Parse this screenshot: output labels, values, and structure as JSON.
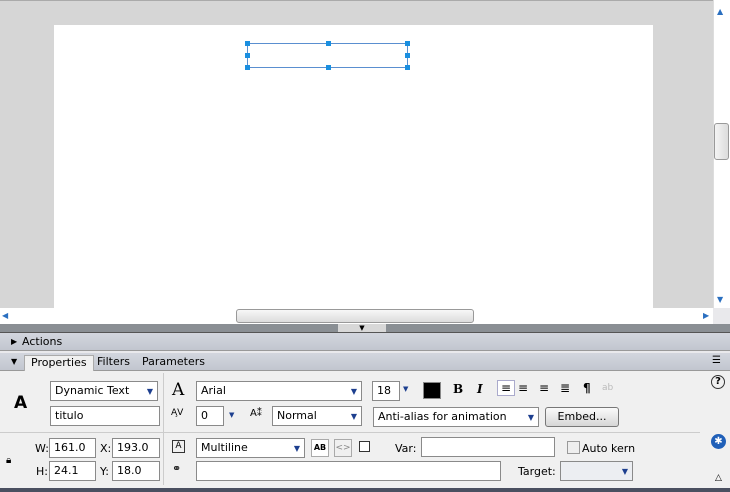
{
  "panels": {
    "actions": "Actions",
    "tabs": [
      "Properties",
      "Filters",
      "Parameters"
    ]
  },
  "props": {
    "text_type": "Dynamic Text",
    "instance_name": "titulo",
    "font": "Arial",
    "font_size": "18",
    "letter_spacing": "0",
    "char_position": "Normal",
    "anti_alias": "Anti-alias for animation",
    "embed": "Embed...",
    "w_label": "W:",
    "w": "161.0",
    "x_label": "X:",
    "x": "193.0",
    "h_label": "H:",
    "h": "24.1",
    "y_label": "Y:",
    "y": "18.0",
    "line_type": "Multiline",
    "var_label": "Var:",
    "var": "",
    "auto_kern": "Auto kern",
    "url": "",
    "target_label": "Target:",
    "target": "",
    "text_color": "#000000"
  }
}
